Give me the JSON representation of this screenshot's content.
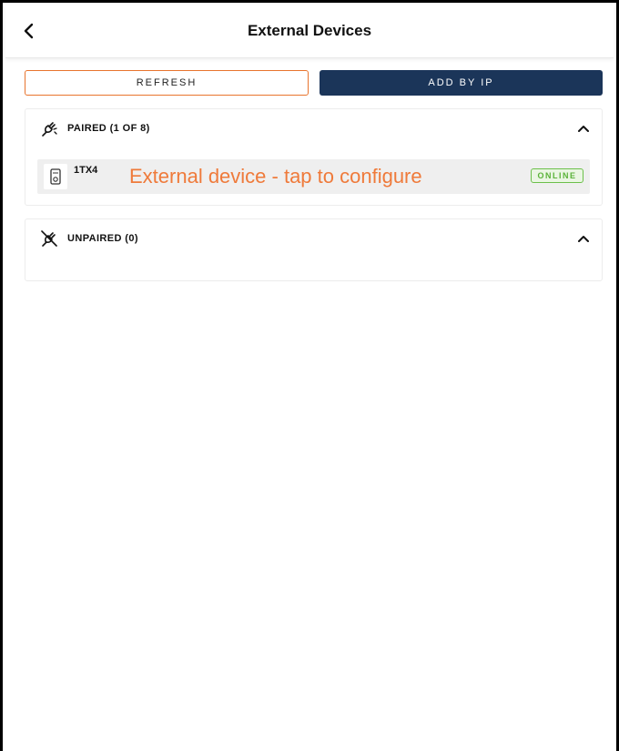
{
  "header": {
    "title": "External Devices",
    "back_icon": "chevron-left-icon"
  },
  "actions": {
    "refresh_label": "REFRESH",
    "add_by_ip_label": "ADD BY IP",
    "accent_color": "#e8742e",
    "primary_color": "#1b3559"
  },
  "paired": {
    "title": "PAIRED (1 OF 8)",
    "icon": "plug-icon",
    "expanded": true,
    "devices": [
      {
        "name": "1TX4",
        "hint": "External device - tap to configure",
        "status": "ONLINE",
        "status_color": "#5bb33a",
        "icon": "device-icon"
      }
    ]
  },
  "unpaired": {
    "title": "UNPAIRED (0)",
    "icon": "unplugged-icon",
    "expanded": true,
    "devices": []
  }
}
